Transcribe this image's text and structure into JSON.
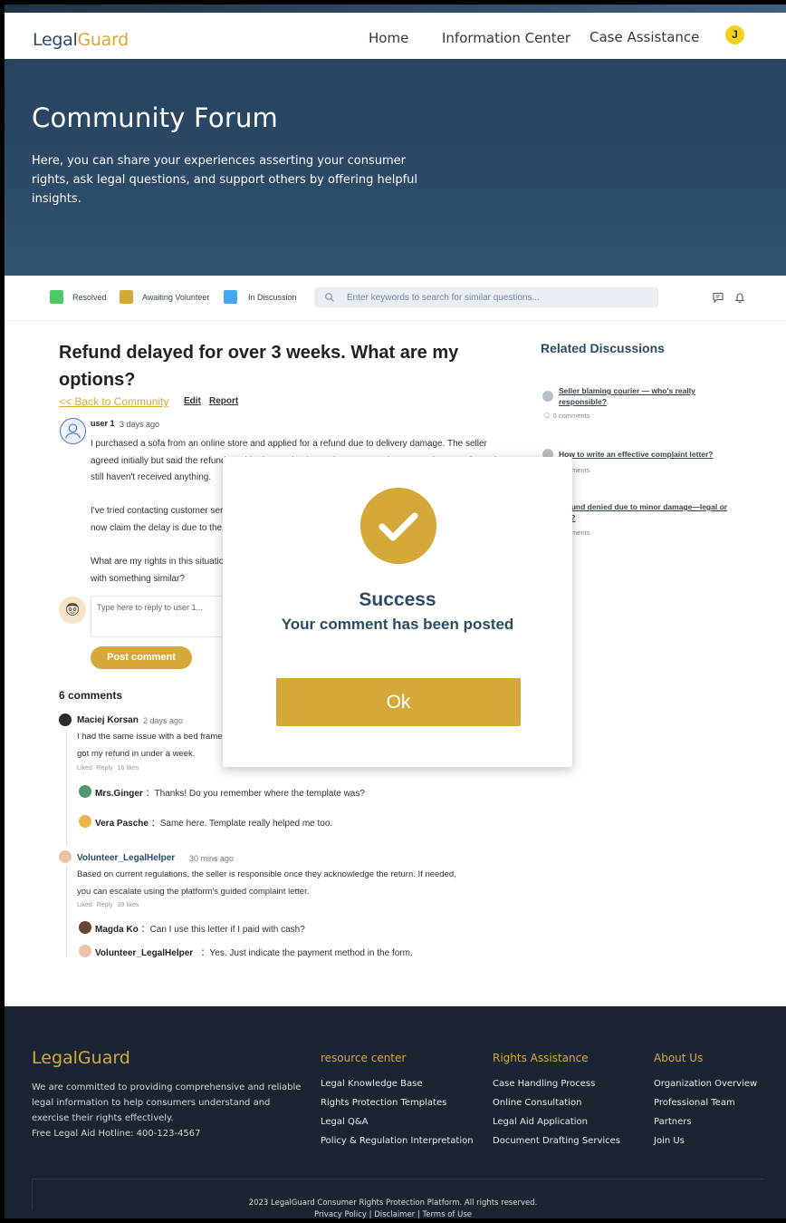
{
  "header": {
    "logo_main": "Legal",
    "logo_accent": "Guard",
    "nav": [
      "Home",
      "Information Center",
      "Case Assistance"
    ],
    "avatar_initial": "J"
  },
  "hero": {
    "title": "Community Forum",
    "description": "Here, you can share your experiences asserting your consumer rights, ask legal questions, and support others by offering helpful insights."
  },
  "filters": {
    "legend": [
      {
        "label": "Resolved",
        "color": "#4cc768"
      },
      {
        "label": "Awaiting Volunteer",
        "color": "#d4a93a"
      },
      {
        "label": "In Discussion",
        "color": "#44a5f0"
      }
    ],
    "search_placeholder": "Enter keywords to search for similar questions..."
  },
  "post": {
    "title": "Refund delayed for over 3 weeks. What are my options?",
    "back_link": "<<  Back to Community",
    "edit": "Edit",
    "report": "Report",
    "user": "user 1",
    "time": "3 days ago",
    "body": [
      "I purchased a sofa from an online store and applied for a refund due to delivery damage. The seller agreed initially but said the refund would take 3–5 business days. It's now been over three weeks and I still haven't received anything.",
      "I've tried contacting customer service multiple times, but they keep giving me vague answers. They now claim the delay is due to the courier.",
      "What are my rights in this situation? Can I escalate this to a regulatory authority? Has anyone dealt with something similar?"
    ],
    "reply_placeholder": "Type here to reply to user 1...",
    "post_button": "Post comment"
  },
  "comments": {
    "count_label": "6 comments",
    "threads": [
      {
        "user": "Maciej Korsan",
        "time": "2 days ago",
        "text": "I had the same issue with a bed frame. I contacted the consumer rights platform, used their template letter and got my refund in under a week.",
        "liked": "Liked",
        "reply": "Reply",
        "likes": "16 likes",
        "replies": [
          {
            "user": "Mrs.Ginger",
            "sep": "：",
            "text": "Thanks! Do you remember where the template was?"
          },
          {
            "user": "Vera Pasche",
            "sep": "：",
            "text": "Same here. Template really helped me too."
          }
        ]
      },
      {
        "user": "Volunteer_LegalHelper",
        "time": "30 mins ago",
        "text": "Based on current regulations, the seller is responsible once they acknowledge the return. If needed, you can escalate using the platform's guided complaint letter.",
        "liked": "Liked",
        "reply": "Reply",
        "likes": "39 likes",
        "replies": [
          {
            "user": "Magda Ko",
            "sep": "：",
            "text": "Can I use this letter if I paid with cash?"
          },
          {
            "user": "Volunteer_LegalHelper",
            "sep": "：",
            "text": "Yes. Just indicate the payment method in the form."
          }
        ]
      }
    ]
  },
  "sidebar": {
    "title": "Related Discussions",
    "items": [
      {
        "title": "Seller blaming courier — who's really responsible?",
        "meta": "0 comments"
      },
      {
        "title": "How to write an effective complaint letter?",
        "meta": "3 comments"
      },
      {
        "title": "Refund denied due to minor damage—legal or not?",
        "meta": "5 comments"
      }
    ]
  },
  "modal": {
    "title": "Success",
    "subtitle": "Your comment has been posted",
    "ok": "Ok"
  },
  "footer": {
    "logo": "LegalGuard",
    "description": "We are committed to providing comprehensive and reliable legal information to help consumers understand and exercise their rights effectively.",
    "hotline": "Free Legal Aid Hotline: 400-123-4567",
    "columns": [
      {
        "title": "resource center",
        "links": [
          "Legal Knowledge Base",
          "Rights Protection Templates",
          "Legal Q&A",
          "Policy & Regulation Interpretation"
        ]
      },
      {
        "title": "Rights Assistance",
        "links": [
          "Case Handling Process",
          "Online Consultation",
          "Legal Aid Application",
          "Document Drafting Services"
        ]
      },
      {
        "title": "About Us",
        "links": [
          "Organization Overview",
          "Professional Team",
          "Partners",
          "Join Us"
        ]
      }
    ],
    "copyright": "2023 LegalGuard Consumer Rights Protection Platform. All rights reserved.",
    "legal_links": [
      "Privacy Policy",
      "Disclaimer",
      "Terms of Use"
    ],
    "legal_sep": " | "
  }
}
